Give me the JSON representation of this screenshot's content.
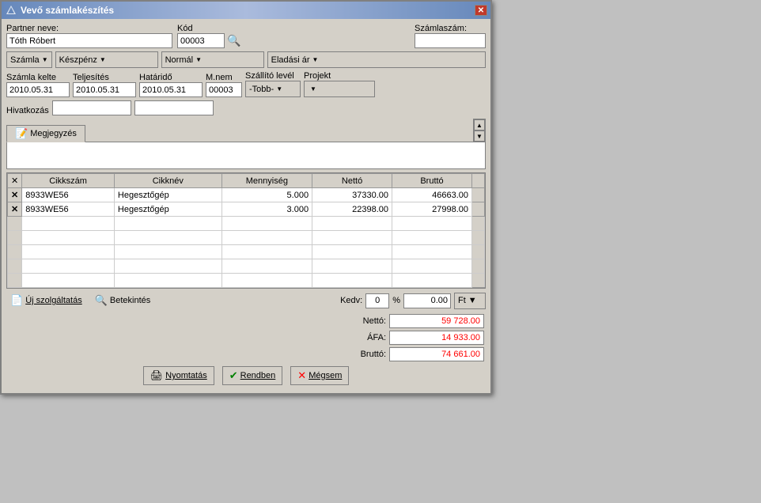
{
  "window": {
    "title": "Vevő számlakészítés",
    "close_label": "✕"
  },
  "header": {
    "partner_label": "Partner neve:",
    "partner_value": "Tóth Róbert",
    "kod_label": "Kód",
    "kod_value": "00003",
    "szamlaszam_label": "Számlaszám:",
    "szamlaszam_value": ""
  },
  "toolbar": {
    "szamla_label": "Számla",
    "fizetmod_label": "Készpénz",
    "normal_label": "Normál",
    "eladasi_label": "Eladási ár"
  },
  "dates": {
    "kelte_label": "Számla kelte",
    "kelte_value": "2010.05.31",
    "teljesites_label": "Teljesítés",
    "teljesites_value": "2010.05.31",
    "hataridő_label": "Határidő",
    "hataridő_value": "2010.05.31",
    "mnem_label": "M.nem",
    "mnem_value": "00003",
    "szallito_label": "Szállító levél",
    "szallito_value": "-Tobb-",
    "projekt_label": "Projekt",
    "projekt_value": ""
  },
  "hivatkozas": {
    "label": "Hivatkozás",
    "value": "",
    "value2": ""
  },
  "megjegyzes": {
    "tab_label": "Megjegyzés"
  },
  "table": {
    "headers": [
      "",
      "Cikkszám",
      "Cikknév",
      "Mennyiség",
      "Nettó",
      "Bruttó"
    ],
    "rows": [
      {
        "icon": "🖼",
        "cikkszam": "8933WE56",
        "ikknev": "Hegesztőgép",
        "mennyiseg": "5.000",
        "netto": "37330.00",
        "brutto": "46663.00"
      },
      {
        "icon": "🖼",
        "cikkszam": "8933WE56",
        "ikknev": "Hegesztőgép",
        "mennyiseg": "3.000",
        "netto": "22398.00",
        "brutto": "27998.00"
      }
    ],
    "empty_rows": 6
  },
  "bottom": {
    "uj_szolgaltatas_label": "Új szolgáltatás",
    "betekintes_label": "Betekintés",
    "kedv_label": "Kedv:",
    "kedv_value": "0",
    "percent_label": "%",
    "kedv_amount": "0.00",
    "currency_label": "Ft",
    "netto_label": "Nettó:",
    "netto_value": "59 728.00",
    "afa_label": "ÁFA:",
    "afa_value": "14 933.00",
    "brutto_label": "Bruttó:",
    "brutto_value": "74 661.00",
    "nyomtatas_label": "Nyomtatás",
    "rendben_label": "Rendben",
    "megsem_label": "Mégsem"
  }
}
